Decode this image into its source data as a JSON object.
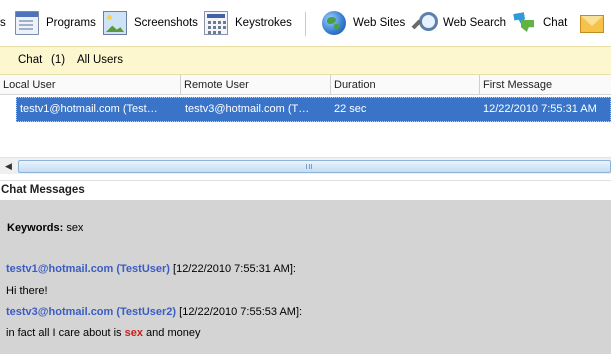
{
  "toolbar": {
    "items": [
      {
        "label": "s",
        "icon": "window-icon"
      },
      {
        "label": "Programs",
        "icon": "programs-icon"
      },
      {
        "label": "Screenshots",
        "icon": "screenshots-icon"
      },
      {
        "label": "Keystrokes",
        "icon": "keystrokes-icon"
      },
      {
        "label": "Web Sites",
        "icon": "globe-icon"
      },
      {
        "label": "Web Search",
        "icon": "search-icon"
      },
      {
        "label": "Chat",
        "icon": "chat-icon"
      },
      {
        "label": "",
        "icon": "email-icon"
      }
    ]
  },
  "chat_bar": {
    "title": "Chat",
    "count": "(1)",
    "filter": "All Users"
  },
  "grid": {
    "columns": [
      "Local User",
      "Remote User",
      "Duration",
      "First Message"
    ],
    "rows": [
      {
        "local_user": "testv1@hotmail.com (Test…",
        "remote_user": "testv3@hotmail.com (T…",
        "duration": "22 sec",
        "first_message": "12/22/2010 7:55:31 AM"
      }
    ]
  },
  "messages": {
    "header": "Chat Messages",
    "keywords_label": "Keywords:",
    "keywords_value": "sex",
    "entries": [
      {
        "sender": "testv1@hotmail.com (TestUser)",
        "timestamp": "[12/22/2010 7:55:31 AM]:",
        "text_before": "Hi there!",
        "highlight": "",
        "text_after": ""
      },
      {
        "sender": "testv3@hotmail.com (TestUser2)",
        "timestamp": "[12/22/2010 7:55:53 AM]:",
        "text_before": "in fact all I care about is ",
        "highlight": "sex",
        "text_after": " and money"
      }
    ]
  },
  "colors": {
    "selection": "#3a74c9",
    "chat_bar_bg": "#fdf7d0",
    "messages_bg": "#d4d4d4",
    "sender": "#3b5cc2",
    "keyword_highlight": "#d11b1b"
  }
}
